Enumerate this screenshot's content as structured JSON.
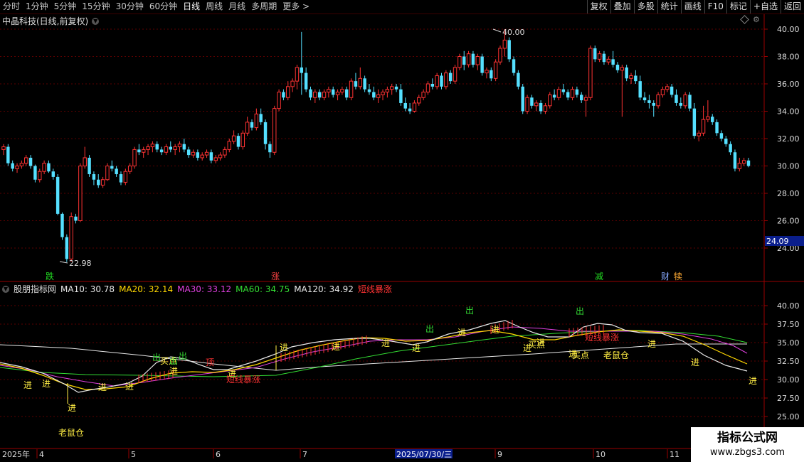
{
  "toolbar": {
    "periods": [
      "分时",
      "1分钟",
      "5分钟",
      "15分钟",
      "30分钟",
      "60分钟",
      "日线",
      "周线",
      "月线",
      "多周期",
      "更多 >"
    ],
    "active_period": "日线",
    "actions": [
      "复权",
      "叠加",
      "多股",
      "统计",
      "画线",
      "F10",
      "标记",
      "+自选",
      "返回"
    ]
  },
  "chart_header": {
    "title": "中晶科技(日线,前复权)"
  },
  "price_axis": {
    "labels": [
      "40.00",
      "38.00",
      "36.00",
      "34.00",
      "32.00",
      "30.00",
      "28.00",
      "26.00",
      "24.00"
    ],
    "current": "24.09"
  },
  "annotations": {
    "high": "40.00",
    "low": "22.98"
  },
  "event_markers": [
    {
      "label": "跌",
      "color": "#22dd22"
    },
    {
      "label": "涨",
      "color": "#ff4444"
    },
    {
      "label": "减",
      "color": "#22dd22"
    },
    {
      "label": "财",
      "color": "#88aaff"
    },
    {
      "label": "犊",
      "color": "#ffaa33"
    }
  ],
  "indicator": {
    "name": "股朋指标网",
    "items": [
      {
        "text": "MA10: 30.78",
        "color": "#e8e8e8"
      },
      {
        "text": "MA20: 32.14",
        "color": "#ffd700"
      },
      {
        "text": "MA30: 33.12",
        "color": "#e040e0"
      },
      {
        "text": "MA60: 34.75",
        "color": "#33dd33"
      },
      {
        "text": "MA120: 34.92",
        "color": "#e8e8e8"
      },
      {
        "text": "短线暴涨",
        "color": "#ff3333"
      }
    ],
    "axis_labels": [
      "40.00",
      "37.50",
      "35.00",
      "32.50",
      "30.00",
      "27.50",
      "25.00"
    ],
    "signal_labels": {
      "in": "进",
      "out": "出",
      "surge": "短线暴涨",
      "buy_point": "买点",
      "old_rat": "老鼠仓",
      "top": "顶"
    }
  },
  "date_axis": {
    "labels": [
      "2025年",
      "4",
      "5",
      "6",
      "7",
      "2025/07/30/三",
      "9",
      "10",
      "11"
    ]
  },
  "watermark": {
    "line1": "指标公式网",
    "line2": "www.zbgs3.com"
  },
  "colors": {
    "up": "#ff3333",
    "down": "#55e0ff",
    "grid": "#5a0000",
    "axis": "#990000"
  },
  "chart_data": {
    "type": "candlestick",
    "series": [
      {
        "values": [
          [
            31.2,
            31.6,
            30.8,
            31.4
          ],
          [
            31.4,
            31.6,
            30.0,
            30.2
          ],
          [
            30.2,
            30.4,
            29.6,
            29.8
          ],
          [
            29.8,
            30.2,
            29.5,
            30.0
          ],
          [
            30.0,
            30.4,
            29.8,
            30.2
          ],
          [
            30.2,
            30.8,
            30.0,
            30.6
          ],
          [
            30.6,
            30.8,
            29.8,
            30.0
          ],
          [
            30.0,
            30.1,
            28.8,
            29.0
          ],
          [
            29.0,
            29.8,
            28.8,
            29.6
          ],
          [
            29.6,
            30.4,
            29.4,
            30.2
          ],
          [
            30.2,
            30.4,
            29.5,
            29.6
          ],
          [
            29.6,
            29.8,
            29.0,
            29.2
          ],
          [
            29.2,
            29.4,
            26.4,
            26.5
          ],
          [
            26.5,
            26.6,
            24.6,
            24.8
          ],
          [
            24.8,
            25.0,
            22.98,
            23.2
          ],
          [
            23.2,
            26.6,
            23.0,
            26.3
          ],
          [
            26.3,
            26.5,
            25.8,
            26.0
          ],
          [
            26.0,
            30.2,
            25.9,
            30.0
          ],
          [
            30.0,
            31.4,
            29.8,
            30.6
          ],
          [
            30.6,
            30.8,
            29.2,
            29.4
          ],
          [
            29.4,
            29.6,
            28.6,
            29.0
          ],
          [
            29.0,
            29.4,
            28.4,
            28.6
          ],
          [
            28.6,
            29.2,
            28.4,
            29.0
          ],
          [
            29.0,
            30.2,
            28.9,
            30.0
          ],
          [
            30.0,
            30.4,
            29.6,
            29.8
          ],
          [
            29.8,
            30.0,
            29.2,
            29.4
          ],
          [
            29.4,
            29.6,
            28.6,
            28.8
          ],
          [
            28.8,
            29.8,
            28.6,
            29.6
          ],
          [
            29.6,
            30.2,
            29.4,
            30.0
          ],
          [
            30.0,
            31.4,
            29.8,
            31.2
          ],
          [
            31.2,
            31.6,
            30.8,
            31.0
          ],
          [
            31.0,
            31.4,
            30.6,
            31.2
          ],
          [
            31.2,
            31.6,
            30.8,
            31.4
          ],
          [
            31.4,
            31.8,
            31.0,
            31.6
          ],
          [
            31.6,
            31.8,
            31.0,
            31.2
          ],
          [
            31.2,
            31.4,
            30.8,
            31.0
          ],
          [
            31.0,
            31.6,
            30.8,
            31.4
          ],
          [
            31.4,
            31.8,
            31.0,
            31.2
          ],
          [
            31.2,
            31.6,
            30.8,
            31.4
          ],
          [
            31.4,
            31.8,
            31.0,
            31.6
          ],
          [
            31.6,
            32.0,
            31.0,
            31.2
          ],
          [
            31.2,
            31.4,
            30.6,
            30.8
          ],
          [
            30.8,
            31.2,
            30.6,
            31.0
          ],
          [
            31.0,
            31.2,
            30.4,
            30.6
          ],
          [
            30.6,
            31.0,
            30.4,
            30.8
          ],
          [
            30.8,
            31.2,
            30.6,
            31.0
          ],
          [
            31.0,
            31.2,
            30.2,
            30.4
          ],
          [
            30.4,
            30.8,
            30.2,
            30.6
          ],
          [
            30.6,
            31.0,
            30.4,
            30.8
          ],
          [
            30.8,
            31.4,
            30.6,
            31.2
          ],
          [
            31.2,
            32.0,
            31.0,
            31.8
          ],
          [
            31.8,
            32.6,
            31.6,
            32.2
          ],
          [
            32.2,
            32.4,
            31.2,
            31.4
          ],
          [
            31.4,
            32.6,
            31.2,
            32.4
          ],
          [
            32.4,
            33.6,
            32.2,
            33.2
          ],
          [
            33.2,
            33.4,
            32.6,
            32.8
          ],
          [
            32.8,
            34.2,
            32.6,
            33.8
          ],
          [
            33.8,
            34.2,
            33.0,
            33.2
          ],
          [
            33.2,
            33.4,
            31.2,
            31.6
          ],
          [
            31.6,
            31.8,
            30.6,
            31.0
          ],
          [
            31.0,
            34.4,
            30.8,
            34.2
          ],
          [
            34.2,
            35.6,
            34.0,
            35.4
          ],
          [
            35.4,
            35.6,
            34.8,
            35.0
          ],
          [
            35.0,
            36.2,
            34.8,
            35.8
          ],
          [
            35.8,
            36.4,
            35.4,
            36.2
          ],
          [
            36.2,
            37.4,
            35.6,
            37.2
          ],
          [
            37.2,
            39.8,
            35.2,
            36.8
          ],
          [
            36.8,
            37.2,
            35.4,
            35.6
          ],
          [
            35.6,
            35.8,
            34.8,
            35.0
          ],
          [
            35.0,
            35.6,
            34.6,
            35.4
          ],
          [
            35.4,
            35.6,
            34.8,
            35.0
          ],
          [
            35.0,
            35.6,
            34.8,
            35.4
          ],
          [
            35.4,
            35.8,
            35.0,
            35.6
          ],
          [
            35.6,
            35.8,
            35.0,
            35.2
          ],
          [
            35.2,
            35.6,
            34.8,
            35.4
          ],
          [
            35.4,
            35.8,
            35.2,
            35.6
          ],
          [
            35.6,
            35.8,
            34.8,
            35.0
          ],
          [
            35.0,
            36.4,
            34.8,
            36.2
          ],
          [
            36.2,
            36.8,
            35.6,
            35.8
          ],
          [
            35.8,
            37.2,
            35.6,
            36.4
          ],
          [
            36.4,
            36.6,
            35.4,
            35.6
          ],
          [
            35.6,
            36.0,
            35.2,
            35.4
          ],
          [
            35.4,
            35.8,
            34.8,
            35.0
          ],
          [
            35.0,
            35.6,
            34.6,
            35.2
          ],
          [
            35.2,
            35.6,
            34.8,
            35.4
          ],
          [
            35.4,
            35.8,
            35.0,
            35.6
          ],
          [
            35.6,
            36.0,
            35.2,
            35.8
          ],
          [
            35.8,
            36.0,
            35.4,
            35.6
          ],
          [
            35.6,
            36.0,
            34.4,
            34.6
          ],
          [
            34.6,
            35.0,
            34.0,
            34.2
          ],
          [
            34.2,
            34.6,
            33.8,
            34.0
          ],
          [
            34.0,
            34.8,
            33.9,
            34.6
          ],
          [
            34.6,
            35.2,
            34.4,
            35.0
          ],
          [
            35.0,
            35.6,
            34.8,
            35.4
          ],
          [
            35.4,
            36.2,
            35.2,
            36.0
          ],
          [
            36.0,
            36.4,
            35.6,
            35.8
          ],
          [
            35.8,
            36.8,
            35.6,
            36.6
          ],
          [
            36.6,
            36.8,
            35.6,
            35.8
          ],
          [
            35.8,
            37.0,
            35.6,
            36.8
          ],
          [
            36.8,
            37.0,
            36.0,
            36.2
          ],
          [
            36.2,
            37.4,
            36.0,
            37.2
          ],
          [
            37.2,
            38.2,
            37.0,
            38.0
          ],
          [
            38.0,
            38.4,
            37.0,
            37.4
          ],
          [
            37.4,
            38.4,
            37.2,
            38.2
          ],
          [
            38.2,
            38.4,
            37.2,
            37.4
          ],
          [
            37.4,
            38.2,
            37.0,
            38.0
          ],
          [
            38.0,
            38.2,
            36.6,
            36.8
          ],
          [
            36.8,
            37.2,
            36.4,
            37.0
          ],
          [
            37.0,
            37.2,
            36.2,
            36.4
          ],
          [
            36.4,
            37.8,
            36.2,
            37.6
          ],
          [
            37.6,
            38.8,
            37.4,
            38.6
          ],
          [
            38.6,
            40.0,
            38.0,
            39.2
          ],
          [
            39.2,
            39.4,
            37.6,
            37.8
          ],
          [
            37.8,
            38.0,
            36.6,
            36.8
          ],
          [
            36.8,
            37.0,
            35.6,
            35.8
          ],
          [
            35.8,
            36.0,
            33.8,
            34.0
          ],
          [
            34.0,
            35.2,
            33.8,
            35.0
          ],
          [
            35.0,
            35.2,
            34.2,
            34.4
          ],
          [
            34.4,
            34.8,
            34.0,
            34.6
          ],
          [
            34.6,
            34.8,
            33.8,
            34.0
          ],
          [
            34.0,
            34.6,
            33.8,
            34.4
          ],
          [
            34.4,
            35.4,
            34.2,
            35.2
          ],
          [
            35.2,
            35.6,
            34.8,
            35.0
          ],
          [
            35.0,
            35.8,
            34.8,
            35.6
          ],
          [
            35.6,
            36.0,
            35.2,
            35.4
          ],
          [
            35.4,
            35.6,
            34.8,
            35.0
          ],
          [
            35.0,
            35.8,
            34.8,
            35.6
          ],
          [
            35.6,
            35.8,
            35.0,
            35.2
          ],
          [
            35.2,
            35.4,
            34.6,
            34.8
          ],
          [
            34.8,
            35.2,
            33.6,
            35.0
          ],
          [
            35.0,
            38.8,
            34.8,
            38.6
          ],
          [
            38.6,
            38.8,
            37.6,
            37.8
          ],
          [
            37.8,
            38.4,
            37.6,
            38.2
          ],
          [
            38.2,
            38.4,
            37.4,
            37.6
          ],
          [
            37.6,
            38.0,
            37.4,
            37.8
          ],
          [
            37.8,
            38.4,
            37.2,
            37.4
          ],
          [
            37.4,
            37.6,
            36.8,
            37.0
          ],
          [
            37.0,
            37.4,
            33.6,
            37.2
          ],
          [
            37.2,
            37.4,
            36.2,
            36.4
          ],
          [
            36.4,
            36.8,
            36.0,
            36.6
          ],
          [
            36.6,
            37.0,
            36.0,
            36.2
          ],
          [
            36.2,
            36.6,
            34.8,
            35.0
          ],
          [
            35.0,
            35.4,
            34.6,
            34.8
          ],
          [
            34.8,
            35.2,
            34.2,
            34.6
          ],
          [
            34.6,
            34.8,
            33.6,
            34.4
          ],
          [
            34.4,
            35.4,
            34.2,
            35.2
          ],
          [
            35.2,
            35.8,
            35.0,
            35.6
          ],
          [
            35.6,
            36.0,
            35.4,
            35.8
          ],
          [
            35.8,
            36.0,
            35.0,
            35.2
          ],
          [
            35.2,
            35.6,
            34.4,
            34.6
          ],
          [
            34.6,
            35.0,
            34.2,
            34.4
          ],
          [
            34.4,
            35.4,
            34.2,
            35.2
          ],
          [
            35.2,
            35.4,
            34.0,
            34.2
          ],
          [
            34.2,
            34.6,
            32.0,
            32.2
          ],
          [
            32.2,
            32.6,
            31.8,
            32.4
          ],
          [
            32.4,
            34.4,
            32.2,
            33.4
          ],
          [
            33.4,
            34.8,
            33.2,
            33.6
          ],
          [
            33.6,
            33.8,
            33.0,
            33.2
          ],
          [
            33.2,
            33.4,
            32.2,
            32.4
          ],
          [
            32.4,
            32.6,
            31.8,
            32.0
          ],
          [
            32.0,
            32.2,
            31.4,
            31.6
          ],
          [
            31.6,
            31.8,
            30.8,
            31.0
          ],
          [
            31.0,
            31.2,
            29.6,
            29.8
          ],
          [
            29.8,
            30.6,
            29.6,
            30.2
          ],
          [
            30.2,
            30.6,
            30.0,
            30.4
          ],
          [
            30.4,
            30.6,
            29.9,
            30.0
          ]
        ]
      }
    ],
    "y_range": [
      22.5,
      41.0
    ]
  }
}
